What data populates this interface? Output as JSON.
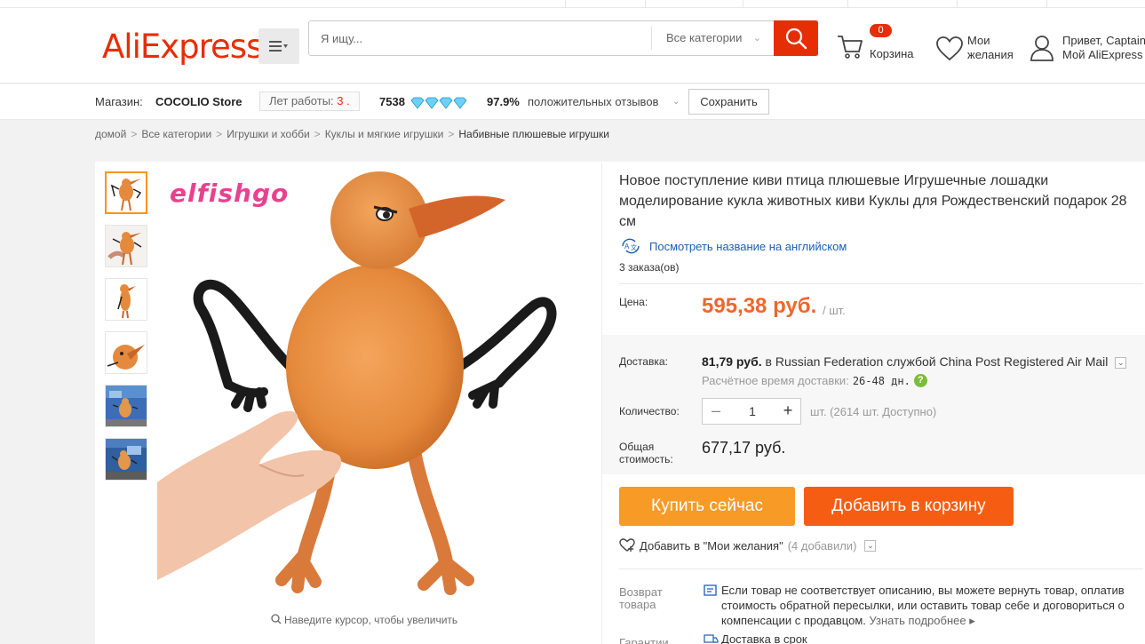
{
  "header": {
    "logo_text": "AliExpress",
    "logo_tm": "™",
    "search_placeholder": "Я ищу...",
    "all_categories": "Все категории",
    "cart_count": "0",
    "cart_label": "Корзина",
    "wishlist_line1": "Мои",
    "wishlist_line2": "желания",
    "account_line1": "Привет, Captain",
    "account_line2": "Мой AliExpress"
  },
  "store": {
    "label": "Магазин:",
    "name": "COCOLIO Store",
    "years_label": "Лет работы:",
    "years_value": "3 .",
    "rating_score": "7538",
    "positive_percent": "97.9%",
    "positive_label": "положительных отзывов",
    "save_label": "Сохранить"
  },
  "breadcrumb": [
    "домой",
    "Все категории",
    "Игрушки и хобби",
    "Куклы и мягкие игрушки",
    "Набивные плюшевые игрушки"
  ],
  "image": {
    "brand_watermark": "elfishgo",
    "zoom_hint": "Наведите курсор, чтобы увеличить"
  },
  "product": {
    "title": "Новое поступление киви птица плюшевые Игрушечные лошадки моделирование кукла животных киви Куклы для Рождественский подарок 28 см",
    "translate_link": "Посмотреть название на английском",
    "orders": "3 заказа(ов)",
    "price_label": "Цена:",
    "price": "595,38 руб.",
    "price_unit": "/ шт.",
    "delivery_label": "Доставка:",
    "delivery_price": "81,79 руб.",
    "delivery_text": "в Russian Federation службой China Post Registered Air Mail",
    "delivery_estimate_label": "Расчётное время доставки:",
    "delivery_estimate_days": "26-48 дн.",
    "quantity_label": "Количество:",
    "quantity_value": "1",
    "availability": "шт. (2614 шт. Доступно)",
    "total_label_1": "Общая",
    "total_label_2": "стоимость:",
    "total": "677,17 руб.",
    "buy_now": "Купить сейчас",
    "add_to_cart": "Добавить в корзину",
    "wishlist_add": "Добавить в \"Мои желания\"",
    "wishlist_count": "(4 добавили)",
    "return_label_1": "Возврат",
    "return_label_2": "товара",
    "return_text": "Если товар не соответствует описанию, вы можете вернуть товар, оплатив стоимость обратной пересылки, или оставить товар себе и договориться о компенсации с продавцом.",
    "return_more": "Узнать подробнее ▸",
    "guarantee_label": "Гарантии",
    "guarantee_text": "Доставка в срок"
  },
  "colors": {
    "brand": "#e62e04",
    "price": "#f0672a",
    "buy_now": "#f79a26",
    "add_to_cart": "#f55e12",
    "link": "#1a5fb4",
    "bird": "#e58a3c"
  }
}
